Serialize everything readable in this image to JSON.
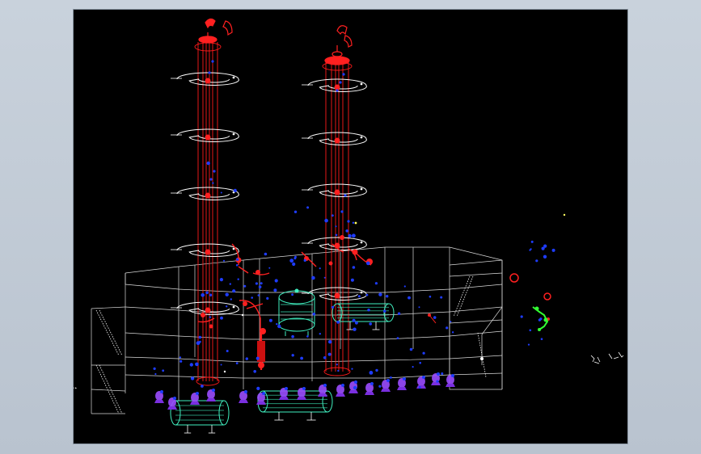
{
  "colors": {
    "background": "#c3ccd6",
    "viewport": "#000000",
    "frame": "#ffffff",
    "column": "#ff1a1a",
    "spiral": "#ffffff",
    "fitting": "#ff2020",
    "instrument": "#1e3cff",
    "tank": "#40f0c0",
    "pump": "#9b4dff",
    "valve_green": "#33ff33"
  },
  "scene": {
    "towers": 2,
    "spiral_rings_per_tower": 5,
    "horizontal_tanks": 3,
    "vertical_tanks": 1,
    "pumps": 16
  }
}
